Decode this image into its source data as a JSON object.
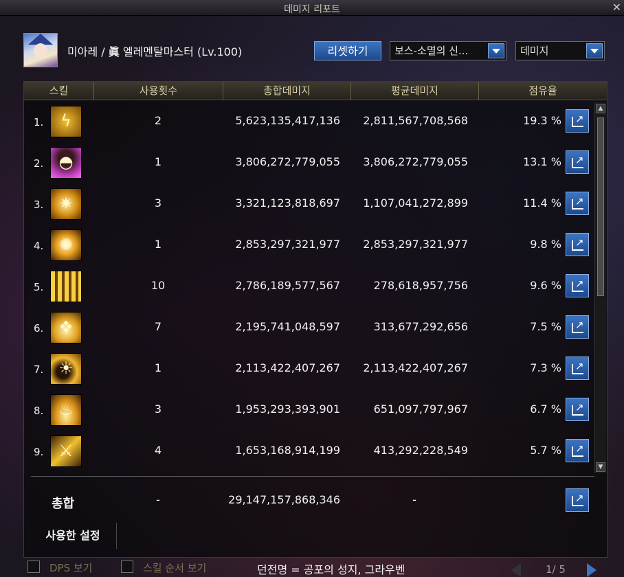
{
  "window": {
    "title": "데미지 리포트",
    "close_glyph": "✕"
  },
  "character": {
    "name": "미아레",
    "separator": "/",
    "class_symbol": "眞",
    "class_name": "엘레멘탈마스터",
    "level": "(Lv.100)"
  },
  "toolbar": {
    "reset_label": "리셋하기",
    "target_dropdown": "보스-소멸의 신...",
    "metric_dropdown": "데미지"
  },
  "table": {
    "headers": [
      "스킬",
      "사용횟수",
      "총합데미지",
      "평균데미지",
      "점유율"
    ],
    "rows": [
      {
        "rank": "1.",
        "icon": "lightning-skill-icon",
        "uses": "2",
        "total": "5,623,135,417,136",
        "average": "2,811,567,708,568",
        "share": "19.3 %"
      },
      {
        "rank": "2.",
        "icon": "dark-dome-skill-icon",
        "uses": "1",
        "total": "3,806,272,779,055",
        "average": "3,806,272,779,055",
        "share": "13.1 %"
      },
      {
        "rank": "3.",
        "icon": "star-burst-skill-icon",
        "uses": "3",
        "total": "3,321,123,818,697",
        "average": "1,107,041,272,899",
        "share": "11.4 %"
      },
      {
        "rank": "4.",
        "icon": "explosion-skill-icon",
        "uses": "1",
        "total": "2,853,297,321,977",
        "average": "2,853,297,321,977",
        "share": "9.8 %"
      },
      {
        "rank": "5.",
        "icon": "pillars-skill-icon",
        "uses": "10",
        "total": "2,786,189,577,567",
        "average": "278,618,957,756",
        "share": "9.6 %"
      },
      {
        "rank": "6.",
        "icon": "crystal-skill-icon",
        "uses": "7",
        "total": "2,195,741,048,597",
        "average": "313,677,292,656",
        "share": "7.5 %"
      },
      {
        "rank": "7.",
        "icon": "sun-skill-icon",
        "uses": "1",
        "total": "2,113,422,407,267",
        "average": "2,113,422,407,267",
        "share": "7.3 %"
      },
      {
        "rank": "8.",
        "icon": "halo-fire-skill-icon",
        "uses": "3",
        "total": "1,953,293,393,901",
        "average": "651,097,797,967",
        "share": "6.7 %"
      },
      {
        "rank": "9.",
        "icon": "slash-skill-icon",
        "uses": "4",
        "total": "1,653,168,914,199",
        "average": "413,292,228,549",
        "share": "5.7 %"
      }
    ],
    "total": {
      "label": "총합",
      "uses": "-",
      "total": "29,147,157,868,346",
      "average": "-"
    }
  },
  "settings_tab": "사용한 설정",
  "footer": {
    "dps_label": "DPS 보기",
    "skill_order_label": "스킬 순서 보기",
    "dungeon": "던전명 = 공포의 성지, 그라우벤",
    "page": "1/ 5"
  },
  "colors": {
    "accent_blue": "#2a5ea8",
    "gold_icon": "#e8b820"
  }
}
